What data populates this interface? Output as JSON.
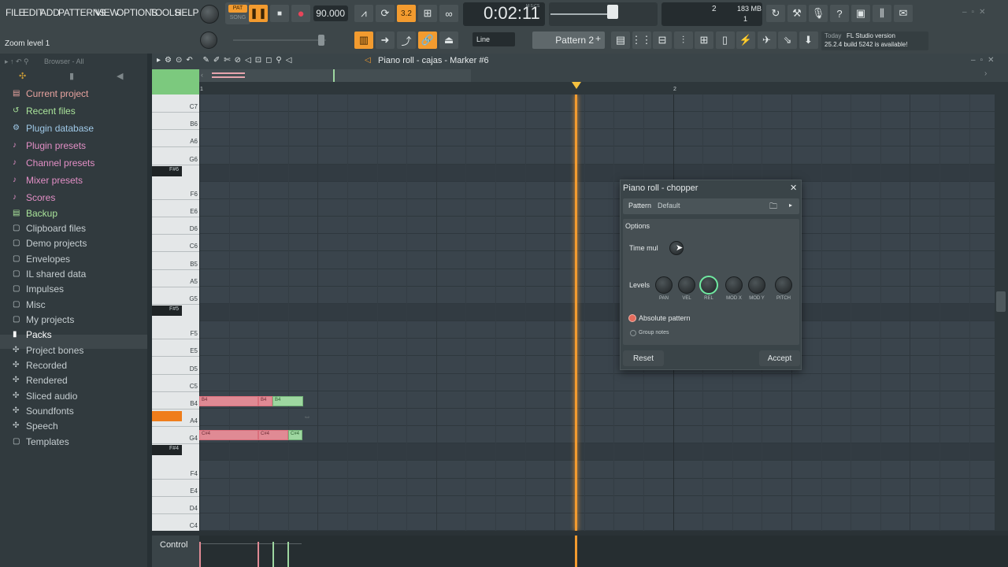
{
  "menu": [
    "FILE",
    "EDIT",
    "ADD",
    "PATTERNS",
    "VIEW",
    "OPTIONS",
    "TOOLS",
    "HELP"
  ],
  "transport": {
    "pat_label": "PAT",
    "song_label": "SONG",
    "tempo": "90.000",
    "time": "0:02:11",
    "time_unit": "M:S:CS",
    "beat": "3.2"
  },
  "memory": {
    "bar": "2",
    "mem": "183 MB",
    "cpu": "1"
  },
  "hint": {
    "title": "Zoom level 1"
  },
  "snap": {
    "label": "Line"
  },
  "pattern": {
    "name": "Pattern 2"
  },
  "news": {
    "line1_prefix": "Today",
    "line1": "FL Studio version",
    "line2": "25.2.4 build 5242 is available!"
  },
  "browser": {
    "label": "Browser - All",
    "items": [
      {
        "label": "Current project",
        "color": "#e8a39f"
      },
      {
        "label": "Recent files",
        "color": "#a9e39a"
      },
      {
        "label": "Plugin database",
        "color": "#9fc9e8"
      },
      {
        "label": "Plugin presets",
        "color": "#e38fc6"
      },
      {
        "label": "Channel presets",
        "color": "#e38fc6"
      },
      {
        "label": "Mixer presets",
        "color": "#e38fc6"
      },
      {
        "label": "Scores",
        "color": "#e38fc6"
      },
      {
        "label": "Backup",
        "color": "#a9e39a"
      },
      {
        "label": "Clipboard files",
        "color": "#c5cdd0"
      },
      {
        "label": "Demo projects",
        "color": "#c5cdd0"
      },
      {
        "label": "Envelopes",
        "color": "#c5cdd0"
      },
      {
        "label": "IL shared data",
        "color": "#c5cdd0"
      },
      {
        "label": "Impulses",
        "color": "#c5cdd0"
      },
      {
        "label": "Misc",
        "color": "#c5cdd0"
      },
      {
        "label": "My projects",
        "color": "#c5cdd0"
      },
      {
        "label": "Packs",
        "color": "#ffffff"
      },
      {
        "label": "Project bones",
        "color": "#c5cdd0"
      },
      {
        "label": "Recorded",
        "color": "#c5cdd0"
      },
      {
        "label": "Rendered",
        "color": "#c5cdd0"
      },
      {
        "label": "Sliced audio",
        "color": "#c5cdd0"
      },
      {
        "label": "Soundfonts",
        "color": "#c5cdd0"
      },
      {
        "label": "Speech",
        "color": "#c5cdd0"
      },
      {
        "label": "Templates",
        "color": "#c5cdd0"
      }
    ]
  },
  "piano_roll": {
    "title": "Piano roll - cajas - Marker #6",
    "bar_numbers": [
      "1",
      "2"
    ],
    "keys": [
      "C7",
      "B6",
      "A6",
      "G6",
      "F#6",
      "F6",
      "E6",
      "D6",
      "C6",
      "B5",
      "A5",
      "G5",
      "F#5",
      "F5",
      "E5",
      "D5",
      "C5",
      "B4",
      "A4",
      "G4",
      "F#4",
      "F4",
      "E4",
      "D4",
      "C4"
    ],
    "notes_b4": [
      "B4",
      "B4",
      "B4"
    ],
    "notes_cs4": [
      "C#4",
      "C#4",
      "C#4"
    ],
    "control_label": "Control"
  },
  "dialog": {
    "title": "Piano roll - chopper",
    "pattern_label": "Pattern",
    "pattern_value": "Default",
    "options_label": "Options",
    "time_mul_label": "Time mul",
    "levels_label": "Levels",
    "level_knobs": [
      "PAN",
      "VEL",
      "REL",
      "MOD X",
      "MOD Y",
      "PITCH"
    ],
    "absolute_pattern": "Absolute pattern",
    "group_notes": "Group notes",
    "reset": "Reset",
    "accept": "Accept"
  }
}
